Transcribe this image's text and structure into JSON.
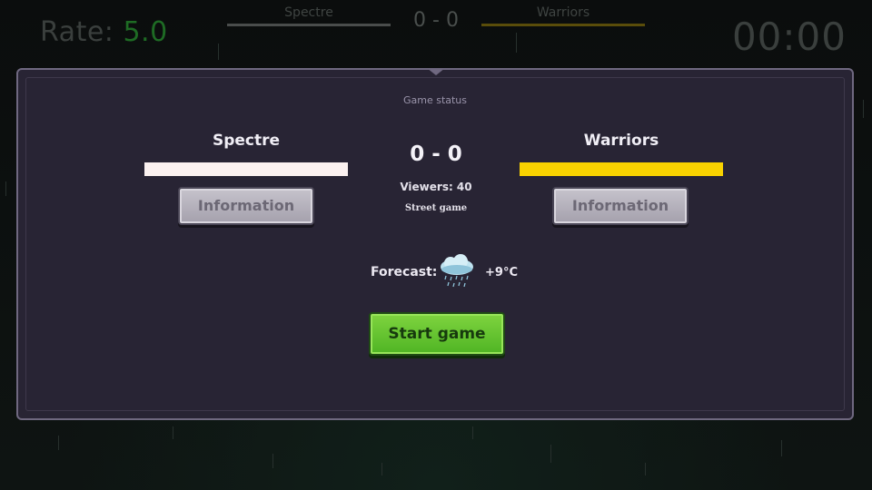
{
  "hud": {
    "rate_label": "Rate:",
    "rate_value": "5.0",
    "home_team": "Spectre",
    "away_team": "Warriors",
    "score": "0 - 0",
    "timer": "00:00"
  },
  "panel": {
    "title": "Game status",
    "home": {
      "name": "Spectre",
      "color": "#fbf1f0",
      "info_button": "Information"
    },
    "away": {
      "name": "Warriors",
      "color": "#f9d200",
      "info_button": "Information"
    },
    "score": "0 - 0",
    "viewers": "Viewers: 40",
    "venue": "Street game",
    "forecast_label": "Forecast:",
    "weather_icon": "rain-cloud-icon",
    "temperature": "+9°C",
    "start_button": "Start game"
  },
  "colors": {
    "panel_bg": "#282434",
    "panel_border": "#6f6880",
    "start_green": "#5cc02e",
    "rate_green": "#1e6b24"
  }
}
